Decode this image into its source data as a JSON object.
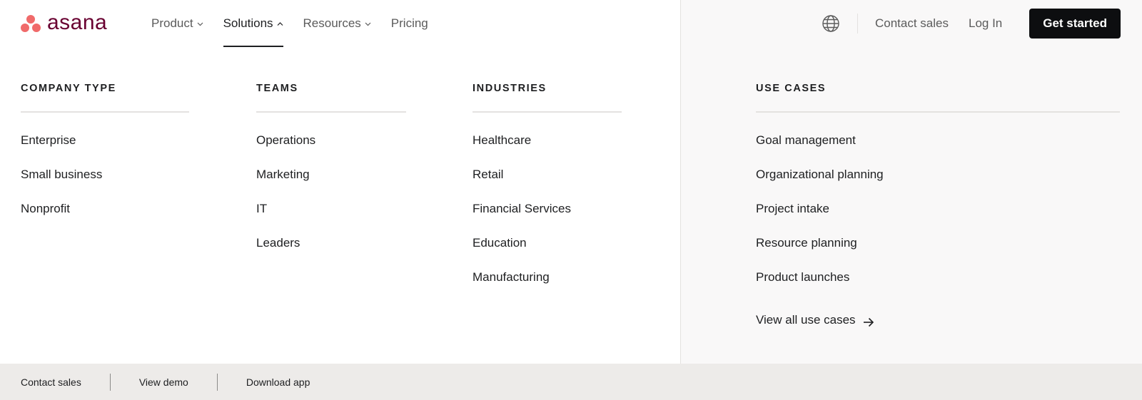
{
  "brand": {
    "name": "asana",
    "logo_color": "#f06a6a",
    "wordmark_color": "#690031"
  },
  "nav": {
    "items": [
      {
        "label": "Product",
        "has_dropdown": true,
        "state": "collapsed"
      },
      {
        "label": "Solutions",
        "has_dropdown": true,
        "state": "expanded",
        "active": true
      },
      {
        "label": "Resources",
        "has_dropdown": true,
        "state": "collapsed"
      },
      {
        "label": "Pricing",
        "has_dropdown": false
      }
    ]
  },
  "header_right": {
    "globe_icon": "globe-icon",
    "contact_sales": "Contact sales",
    "log_in": "Log In",
    "get_started": "Get started"
  },
  "columns": {
    "company_type": {
      "title": "COMPANY TYPE",
      "items": [
        "Enterprise",
        "Small business",
        "Nonprofit"
      ]
    },
    "teams": {
      "title": "TEAMS",
      "items": [
        "Operations",
        "Marketing",
        "IT",
        "Leaders"
      ]
    },
    "industries": {
      "title": "INDUSTRIES",
      "items": [
        "Healthcare",
        "Retail",
        "Financial Services",
        "Education",
        "Manufacturing"
      ]
    },
    "use_cases": {
      "title": "USE CASES",
      "items": [
        "Goal management",
        "Organizational planning",
        "Project intake",
        "Resource planning",
        "Product launches"
      ],
      "view_all": "View all use cases"
    }
  },
  "footer": {
    "links": [
      "Contact sales",
      "View demo",
      "Download app"
    ]
  }
}
